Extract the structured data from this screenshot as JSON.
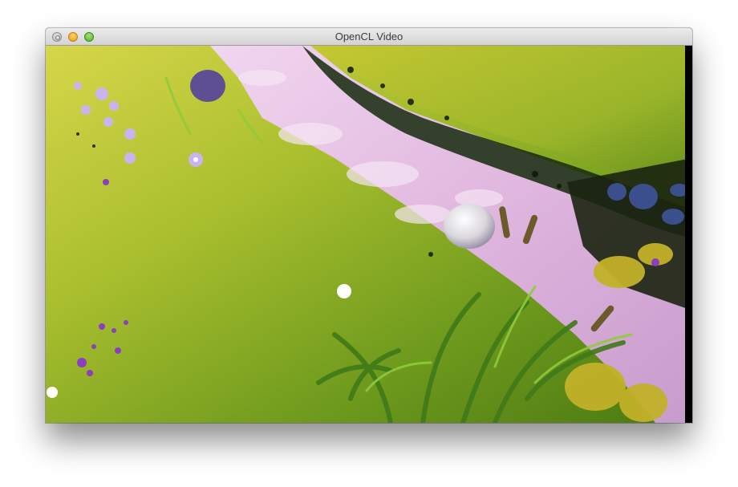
{
  "window": {
    "title": "OpenCL Video",
    "traffic_lights": [
      "close",
      "minimize",
      "zoom"
    ]
  },
  "video": {
    "content": "animated-garden-scene"
  },
  "colors": {
    "grass_light": "#c9cf3a",
    "grass_dark": "#4f7a12",
    "path_pink": "#e8c4e6",
    "path_shadow": "#8a5f9a",
    "titlebar": "#dcdcdc"
  }
}
